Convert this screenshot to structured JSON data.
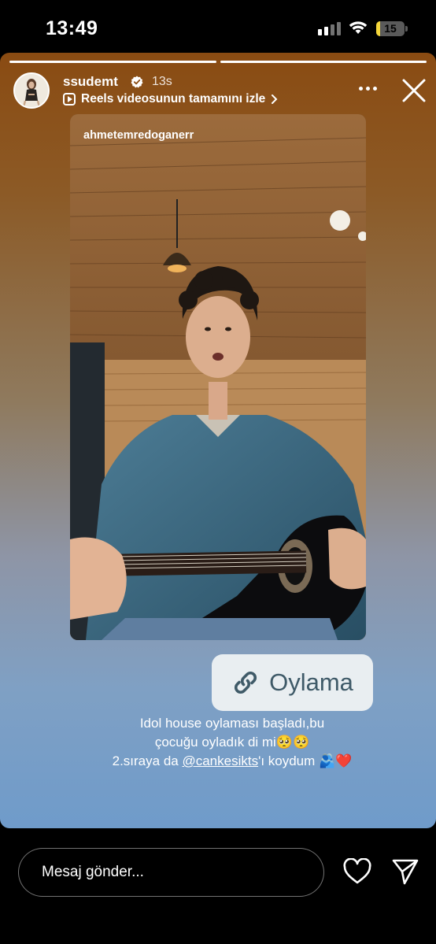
{
  "status_bar": {
    "time": "13:49",
    "battery_level": "15",
    "battery_fraction": 0.15,
    "battery_color": "#f4d63a"
  },
  "story": {
    "progress_segments": [
      1.0,
      1.0
    ],
    "username": "ssudemt",
    "verified": true,
    "time_ago": "13s",
    "reels_link_label": "Reels videosunun tamamını izle",
    "reel_author": "ahmetemredoganerr",
    "link_sticker_label": "Oylama",
    "caption_line1": "Idol house oylaması başladı,bu",
    "caption_line2": "çocuğu oyladık di mi🥺🥺",
    "caption_line3_prefix": "2.sıraya da ",
    "caption_mention": "@cankesikts",
    "caption_line3_suffix": "'ı koydum 🫂❤️"
  },
  "reply_bar": {
    "placeholder": "Mesaj gönder..."
  },
  "icons": [
    "signal-icon",
    "wifi-icon",
    "battery-icon",
    "verified-icon",
    "reels-icon",
    "chevron-right-icon",
    "more-icon",
    "close-icon",
    "link-icon",
    "heart-icon",
    "send-icon"
  ]
}
